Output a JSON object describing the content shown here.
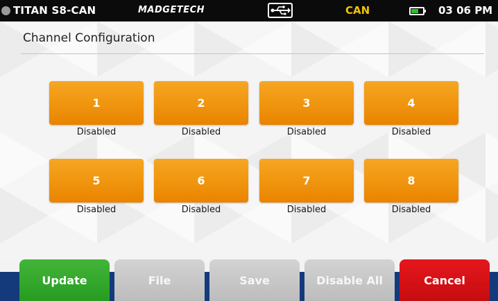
{
  "status_bar": {
    "device_name": "TITAN S8-CAN",
    "brand": "MADGETECH",
    "mode": "CAN",
    "time": "03 06 PM",
    "battery_level": 0.6,
    "colors": {
      "background": "#0b0b0b",
      "mode_text": "#f2c300",
      "battery_fill": "#2fc12f"
    }
  },
  "page": {
    "title": "Channel Configuration"
  },
  "channels": [
    {
      "label": "1",
      "status": "Disabled"
    },
    {
      "label": "2",
      "status": "Disabled"
    },
    {
      "label": "3",
      "status": "Disabled"
    },
    {
      "label": "4",
      "status": "Disabled"
    },
    {
      "label": "5",
      "status": "Disabled"
    },
    {
      "label": "6",
      "status": "Disabled"
    },
    {
      "label": "7",
      "status": "Disabled"
    },
    {
      "label": "8",
      "status": "Disabled"
    }
  ],
  "toolbar": {
    "update_label": "Update",
    "file_label": "File",
    "save_label": "Save",
    "disable_all_label": "Disable All",
    "cancel_label": "Cancel",
    "colors": {
      "update": "#279c21",
      "neutral": "#c8c8c8",
      "cancel": "#d01216",
      "band": "#143a7c",
      "channel_button": "#f0940e"
    }
  },
  "icons": {
    "status_dot": "status-dot-icon",
    "usb": "usb-icon",
    "battery": "battery-icon"
  }
}
